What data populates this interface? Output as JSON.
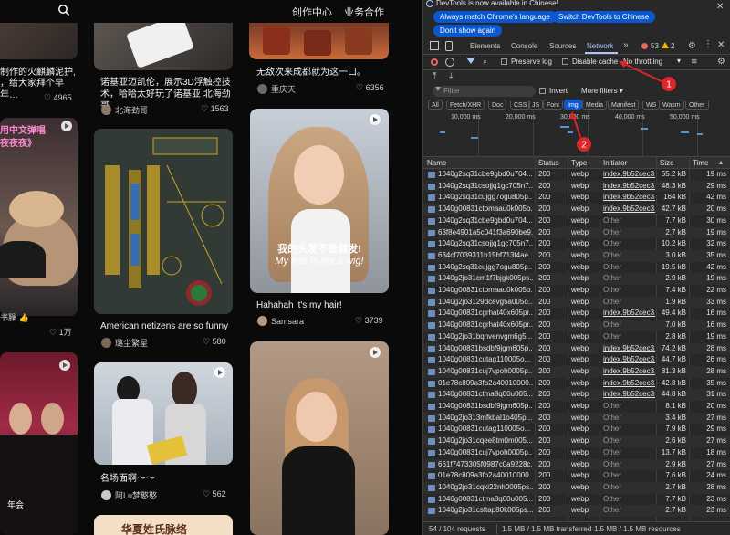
{
  "feed": {
    "nav": {
      "creator": "创作中心",
      "business": "业务合作"
    },
    "col1": [
      {
        "title_top": "制作的火麒麟泥护,",
        "title_bot": "，给大家拜个早年…",
        "likes": "4965"
      },
      {
        "overlay1": "用中文弹唱",
        "overlay2": "夜夜夜》",
        "author": "书臊 👍",
        "likes": "1万"
      },
      {
        "caption": "年会"
      }
    ],
    "col2": [
      {
        "title_top": "诺基亚迈凯伦，展示3D浮触控技",
        "title_bot": "术，哈哈太好玩了诺基亚 北海劲哥",
        "author": "北海劲哥",
        "likes": "1563"
      },
      {
        "title": "American netizens are so funny",
        "author": "璐尘繁星",
        "likes": "580"
      },
      {
        "title": "名场面啊～～",
        "author": "阿Lu梦憨憨",
        "likes": "562"
      },
      {
        "banner": "华夏姓氏脉络"
      }
    ],
    "col3": [
      {
        "title": "无敌次来成都就为这一口。",
        "author": "重庆天",
        "likes": "6356"
      },
      {
        "sub_cn": "我的头发不是假发!",
        "sub_en": "My hair is not a wig!",
        "title": "Hahahah it's my hair!",
        "author": "Samsara",
        "likes": "3739"
      }
    ]
  },
  "devtools": {
    "banner_text": "DevTools is now available in Chinese!",
    "btn_match": "Always match Chrome's language",
    "btn_switch": "Switch DevTools to Chinese",
    "btn_dont": "Don't show again",
    "tabs": {
      "elements": "Elements",
      "console": "Console",
      "sources": "Sources",
      "network": "Network",
      "more": "»"
    },
    "errors": "53",
    "warnings": "2",
    "preserve_log": "Preserve log",
    "disable_cache": "Disable cache",
    "throttling": "No throttling",
    "filter_placeholder": "Filter",
    "invert": "Invert",
    "more_filters": "More filters ▾",
    "chips": [
      "All",
      "Fetch/XHR",
      "Doc",
      "CSS",
      "JS",
      "Font",
      "Img",
      "Media",
      "Manifest",
      "WS",
      "Wasm",
      "Other"
    ],
    "timeline_labels": [
      "10,000 ms",
      "20,000 ms",
      "30,000 ms",
      "40,000 ms",
      "50,000 ms"
    ],
    "columns": {
      "name": "Name",
      "status": "Status",
      "type": "Type",
      "initiator": "Initiator",
      "size": "Size",
      "time": "Time"
    },
    "rows": [
      {
        "name": "1040g2sq31cbe9gbd0u704...",
        "status": "200",
        "type": "webp",
        "initiator": "index.9b52cec3.j",
        "size": "55.2 kB",
        "time": "19 ms"
      },
      {
        "name": "1040g2sq31csojjq1gc705n7...",
        "status": "200",
        "type": "webp",
        "initiator": "index.9b52cec3.j",
        "size": "48.3 kB",
        "time": "29 ms"
      },
      {
        "name": "1040g2sq31cujgg7ogu805p...",
        "status": "200",
        "type": "webp",
        "initiator": "index.9b52cec3.j",
        "size": "164 kB",
        "time": "42 ms"
      },
      {
        "name": "1040g00831ctomaau0k005o...",
        "status": "200",
        "type": "webp",
        "initiator": "index.9b52cec3.j",
        "size": "42.7 kB",
        "time": "20 ms"
      },
      {
        "name": "1040g2sq31cbe9gbd0u704...",
        "status": "200",
        "type": "webp",
        "initiator": "Other",
        "size": "7.7 kB",
        "time": "30 ms"
      },
      {
        "name": "63f8e4901a5c041f3a690be9...",
        "status": "200",
        "type": "webp",
        "initiator": "Other",
        "size": "2.7 kB",
        "time": "19 ms"
      },
      {
        "name": "1040g2sq31csojjq1gc705n7...",
        "status": "200",
        "type": "webp",
        "initiator": "Other",
        "size": "10.2 kB",
        "time": "32 ms"
      },
      {
        "name": "634cf7039311b15bf713f4ae...",
        "status": "200",
        "type": "webp",
        "initiator": "Other",
        "size": "3.0 kB",
        "time": "35 ms"
      },
      {
        "name": "1040g2sq31cujgg7ogu805p...",
        "status": "200",
        "type": "webp",
        "initiator": "Other",
        "size": "19.5 kB",
        "time": "42 ms"
      },
      {
        "name": "1040g2jo31cm1f7bjgk005ps...",
        "status": "200",
        "type": "webp",
        "initiator": "Other",
        "size": "2.9 kB",
        "time": "19 ms"
      },
      {
        "name": "1040g00831ctomaau0k005o...",
        "status": "200",
        "type": "webp",
        "initiator": "Other",
        "size": "7.4 kB",
        "time": "22 ms"
      },
      {
        "name": "1040g2jo3129dcevg5a005o...",
        "status": "200",
        "type": "webp",
        "initiator": "Other",
        "size": "1.9 kB",
        "time": "33 ms"
      },
      {
        "name": "1040g00831cgrhat40x605pr...",
        "status": "200",
        "type": "webp",
        "initiator": "index.9b52cec3.j",
        "size": "49.4 kB",
        "time": "16 ms"
      },
      {
        "name": "1040g00831cgrhat40x605pr...",
        "status": "200",
        "type": "webp",
        "initiator": "Other",
        "size": "7.0 kB",
        "time": "16 ms"
      },
      {
        "name": "1040g2jo31bqnvenvgm6g5...",
        "status": "200",
        "type": "webp",
        "initiator": "Other",
        "size": "2.8 kB",
        "time": "19 ms"
      },
      {
        "name": "1040g00831bsdbf9jgm605p...",
        "status": "200",
        "type": "webp",
        "initiator": "index.9b52cec3.j",
        "size": "74.2 kB",
        "time": "28 ms"
      },
      {
        "name": "1040g00831cutag110005o...",
        "status": "200",
        "type": "webp",
        "initiator": "index.9b52cec3.j",
        "size": "44.7 kB",
        "time": "26 ms"
      },
      {
        "name": "1040g00831cuj7vpoh0005p...",
        "status": "200",
        "type": "webp",
        "initiator": "index.9b52cec3.j",
        "size": "81.3 kB",
        "time": "28 ms"
      },
      {
        "name": "01e78c809a3fb2a40010000...",
        "status": "200",
        "type": "webp",
        "initiator": "index.9b52cec3.j",
        "size": "42.8 kB",
        "time": "35 ms"
      },
      {
        "name": "1040g00831ctma8q00u005...",
        "status": "200",
        "type": "webp",
        "initiator": "index.9b52cec3.j",
        "size": "44.8 kB",
        "time": "31 ms"
      },
      {
        "name": "1040g00831bsdbf9jgm605p...",
        "status": "200",
        "type": "webp",
        "initiator": "Other",
        "size": "8.1 kB",
        "time": "20 ms"
      },
      {
        "name": "1040g2jo313mfkbal1o405p...",
        "status": "200",
        "type": "webp",
        "initiator": "Other",
        "size": "3.4 kB",
        "time": "27 ms"
      },
      {
        "name": "1040g00831cutag110005o...",
        "status": "200",
        "type": "webp",
        "initiator": "Other",
        "size": "7.9 kB",
        "time": "29 ms"
      },
      {
        "name": "1040g2jo31cqee8tm0m005...",
        "status": "200",
        "type": "webp",
        "initiator": "Other",
        "size": "2.6 kB",
        "time": "27 ms"
      },
      {
        "name": "1040g00831cuj7vpoh0005p...",
        "status": "200",
        "type": "webp",
        "initiator": "Other",
        "size": "13.7 kB",
        "time": "18 ms"
      },
      {
        "name": "661f7473305f0987c0a9228c...",
        "status": "200",
        "type": "webp",
        "initiator": "Other",
        "size": "2.9 kB",
        "time": "27 ms"
      },
      {
        "name": "01e78c809a3fb2a40010000...",
        "status": "200",
        "type": "webp",
        "initiator": "Other",
        "size": "7.6 kB",
        "time": "24 ms"
      },
      {
        "name": "1040g2jo31cqki22nh0005ps...",
        "status": "200",
        "type": "webp",
        "initiator": "Other",
        "size": "2.7 kB",
        "time": "28 ms"
      },
      {
        "name": "1040g00831ctma8q00u005...",
        "status": "200",
        "type": "webp",
        "initiator": "Other",
        "size": "7.7 kB",
        "time": "23 ms"
      },
      {
        "name": "1040g2jo31csftap80k005ps...",
        "status": "200",
        "type": "webp",
        "initiator": "Other",
        "size": "2.7 kB",
        "time": "23 ms"
      }
    ],
    "status_requests": "54 / 104 requests",
    "status_transferred": "1.5 MB / 1.5 MB transferred",
    "status_resources": "1.5 MB / 1.5 MB resources",
    "annotations": [
      "1",
      "2"
    ],
    "accent": "#0b57d0",
    "annotation_color": "#e0242b"
  }
}
